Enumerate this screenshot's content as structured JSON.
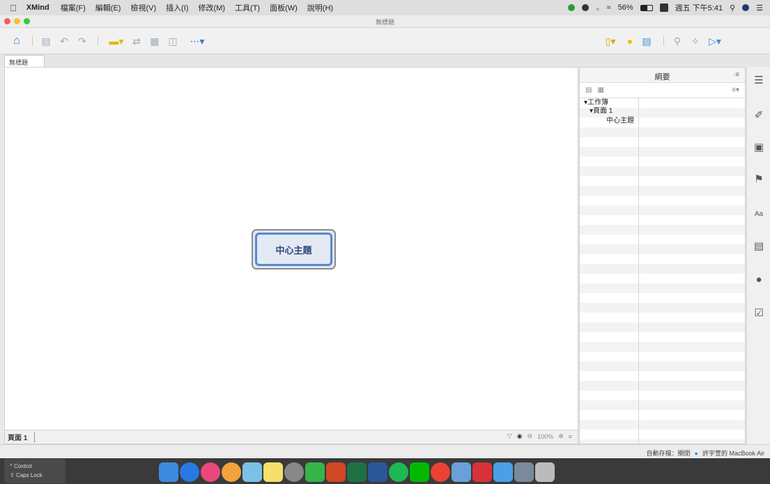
{
  "menubar": {
    "apple": "",
    "app": "XMind",
    "items": [
      "檔案(F)",
      "編輯(E)",
      "檢視(V)",
      "插入(I)",
      "修改(M)",
      "工具(T)",
      "面板(W)",
      "說明(H)"
    ],
    "battery": "56%",
    "datetime": "週五 下午5:41"
  },
  "window": {
    "title": "無標題"
  },
  "tab": {
    "label": "無標題"
  },
  "canvas": {
    "central_topic": "中心主題"
  },
  "sheet": {
    "tab": "頁面 1",
    "zoom": "100%"
  },
  "outline": {
    "title": "綱要",
    "rows": [
      {
        "label": "▾工作簿"
      },
      {
        "label": "▾頁面 1"
      },
      {
        "label": "中心主題"
      }
    ]
  },
  "status": {
    "autosave": "自動存檔：關閉",
    "device": "許宇萱的 MacBook Air"
  },
  "keys": {
    "control": "^ Control",
    "capslock": "⇪ Caps Lock"
  },
  "colors": {
    "accent": "#5a89c8",
    "topic_fill": "#e3e9f5"
  }
}
